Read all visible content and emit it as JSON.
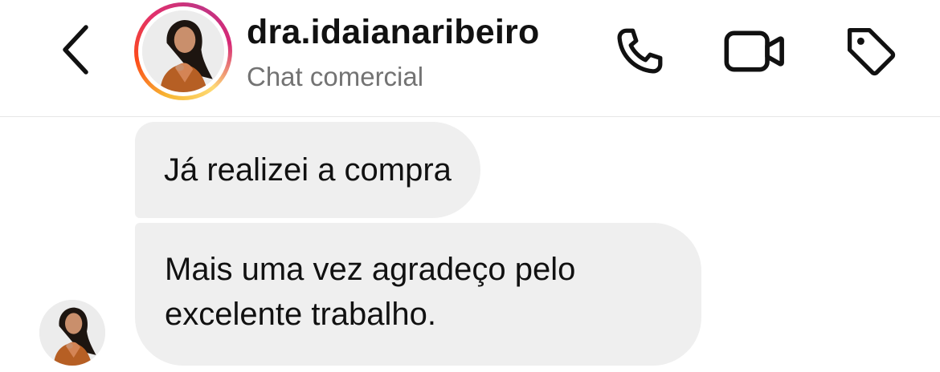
{
  "header": {
    "username": "dra.idaianaribeiro",
    "subtitle": "Chat comercial",
    "back_icon": "chevron-left-icon",
    "call_icon": "phone-icon",
    "video_icon": "video-camera-icon",
    "tag_icon": "tag-icon"
  },
  "colors": {
    "bubble_background": "#efefef",
    "subtitle_text": "#737373",
    "story_ring_gradient": [
      "#feda75",
      "#fa7e1e",
      "#d62976",
      "#962fbf"
    ]
  },
  "messages": [
    {
      "lines": [
        "Já realizei a compra"
      ]
    },
    {
      "lines": [
        "Mais uma vez agradeço pelo",
        "excelente trabalho."
      ]
    }
  ]
}
